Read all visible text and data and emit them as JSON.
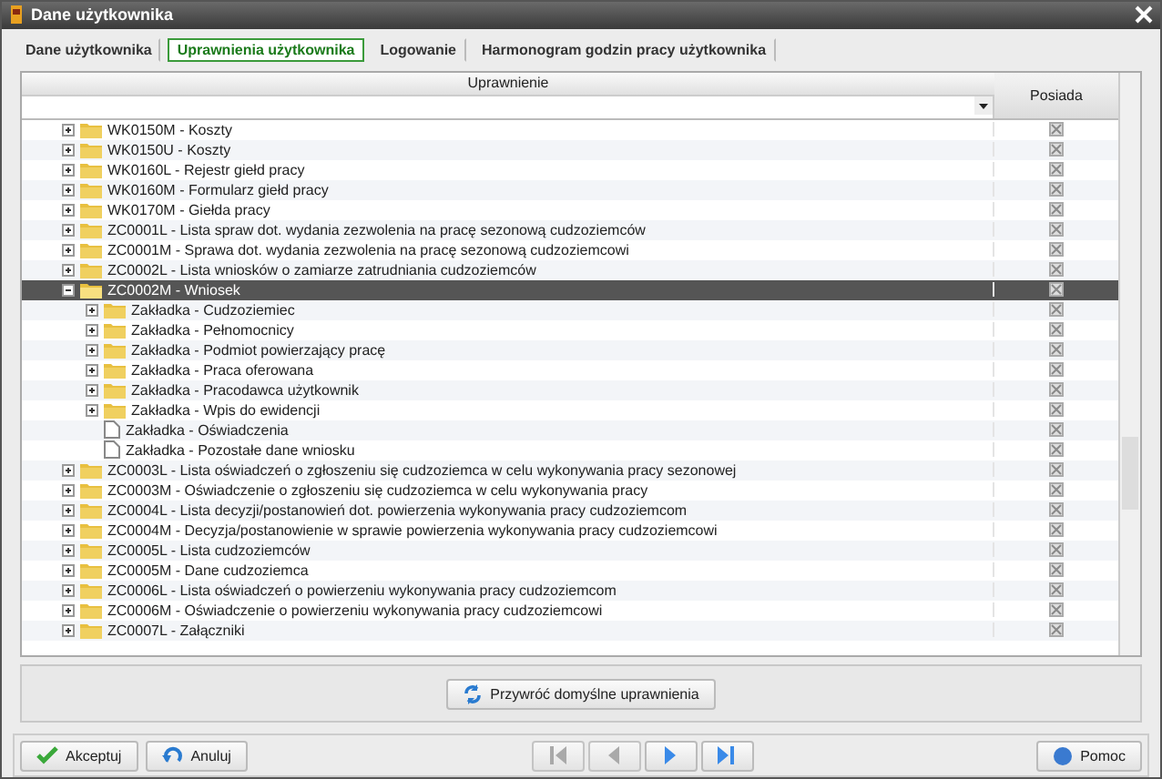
{
  "window": {
    "title": "Dane użytkownika"
  },
  "tabs": [
    {
      "label": "Dane użytkownika",
      "selected": false
    },
    {
      "label": "Uprawnienia użytkownika",
      "selected": true
    },
    {
      "label": "Logowanie",
      "selected": false
    },
    {
      "label": "Harmonogram godzin pracy użytkownika",
      "selected": false
    }
  ],
  "grid": {
    "columns": [
      "Uprawnienie",
      "Posiada"
    ],
    "rows": [
      {
        "kind": "folder",
        "label": "WK0150M - Koszty",
        "expanded": false,
        "selected": false,
        "checked": true
      },
      {
        "kind": "folder",
        "label": "WK0150U - Koszty",
        "expanded": false,
        "selected": false,
        "checked": true
      },
      {
        "kind": "folder",
        "label": "WK0160L - Rejestr giełd pracy",
        "expanded": false,
        "selected": false,
        "checked": true
      },
      {
        "kind": "folder",
        "label": "WK0160M - Formularz giełd pracy",
        "expanded": false,
        "selected": false,
        "checked": true
      },
      {
        "kind": "folder",
        "label": "WK0170M - Giełda pracy",
        "expanded": false,
        "selected": false,
        "checked": true
      },
      {
        "kind": "folder",
        "label": "ZC0001L - Lista spraw dot. wydania zezwolenia na pracę sezonową cudzoziemców",
        "expanded": false,
        "selected": false,
        "checked": true
      },
      {
        "kind": "folder",
        "label": "ZC0001M - Sprawa dot. wydania zezwolenia na pracę sezonową cudzoziemcowi",
        "expanded": false,
        "selected": false,
        "checked": true
      },
      {
        "kind": "folder",
        "label": "ZC0002L - Lista wniosków o zamiarze zatrudniania cudzoziemców",
        "expanded": false,
        "selected": false,
        "checked": true
      },
      {
        "kind": "folder",
        "label": "ZC0002M - Wniosek",
        "expanded": true,
        "selected": true,
        "checked": true,
        "children": [
          {
            "kind": "folder",
            "label": "Zakładka - Cudzoziemiec",
            "expanded": false,
            "selected": false,
            "checked": true
          },
          {
            "kind": "folder",
            "label": "Zakładka - Pełnomocnicy",
            "expanded": false,
            "selected": false,
            "checked": true
          },
          {
            "kind": "folder",
            "label": "Zakładka - Podmiot powierzający pracę",
            "expanded": false,
            "selected": false,
            "checked": true
          },
          {
            "kind": "folder",
            "label": "Zakładka - Praca oferowana",
            "expanded": false,
            "selected": false,
            "checked": true
          },
          {
            "kind": "folder",
            "label": "Zakładka - Pracodawca użytkownik",
            "expanded": false,
            "selected": false,
            "checked": true
          },
          {
            "kind": "folder",
            "label": "Zakładka - Wpis do ewidencji",
            "expanded": false,
            "selected": false,
            "checked": true
          },
          {
            "kind": "document",
            "label": "Zakładka - Oświadczenia",
            "selected": false,
            "checked": true
          },
          {
            "kind": "document",
            "label": "Zakładka - Pozostałe dane wniosku",
            "selected": false,
            "checked": true
          }
        ]
      },
      {
        "kind": "folder",
        "label": "ZC0003L - Lista oświadczeń o zgłoszeniu się cudzoziemca w celu wykonywania pracy sezonowej",
        "expanded": false,
        "selected": false,
        "checked": true
      },
      {
        "kind": "folder",
        "label": "ZC0003M - Oświadczenie o zgłoszeniu się cudzoziemca w celu wykonywania pracy",
        "expanded": false,
        "selected": false,
        "checked": true
      },
      {
        "kind": "folder",
        "label": "ZC0004L - Lista decyzji/postanowień dot. powierzenia wykonywania pracy cudzoziemcom",
        "expanded": false,
        "selected": false,
        "checked": true
      },
      {
        "kind": "folder",
        "label": "ZC0004M - Decyzja/postanowienie w sprawie powierzenia wykonywania pracy cudzoziemcowi",
        "expanded": false,
        "selected": false,
        "checked": true
      },
      {
        "kind": "folder",
        "label": "ZC0005L - Lista cudzoziemców",
        "expanded": false,
        "selected": false,
        "checked": true
      },
      {
        "kind": "folder",
        "label": "ZC0005M - Dane cudzoziemca",
        "expanded": false,
        "selected": false,
        "checked": true
      },
      {
        "kind": "folder",
        "label": "ZC0006L - Lista oświadczeń o powierzeniu wykonywania pracy cudzoziemcom",
        "expanded": false,
        "selected": false,
        "checked": true
      },
      {
        "kind": "folder",
        "label": "ZC0006M - Oświadczenie o powierzeniu wykonywania pracy cudzoziemcowi",
        "expanded": false,
        "selected": false,
        "checked": true
      },
      {
        "kind": "folder",
        "label": "ZC0007L - Załączniki",
        "expanded": false,
        "selected": false,
        "checked": true
      }
    ]
  },
  "restore_button": "Przywróć domyślne uprawnienia",
  "footer": {
    "accept": "Akceptuj",
    "cancel": "Anuluj",
    "help": "Pomoc",
    "nav": [
      {
        "kind": "first",
        "disabled": true
      },
      {
        "kind": "prev",
        "disabled": true
      },
      {
        "kind": "next",
        "disabled": false
      },
      {
        "kind": "last",
        "disabled": false
      }
    ]
  }
}
